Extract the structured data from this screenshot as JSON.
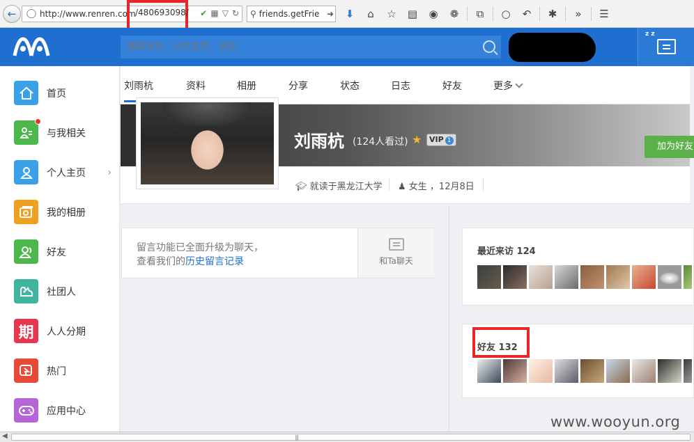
{
  "browser": {
    "url_prefix": "http://www.renren.com",
    "url_id": "/480693098/",
    "search_text": "friends.getFrie"
  },
  "site": {
    "search_placeholder": "搜索好友，公共主页，状态"
  },
  "sidebar": {
    "items": [
      {
        "label": "首页",
        "icon": "home-icon",
        "color": "#3aa0e8"
      },
      {
        "label": "与我相关",
        "icon": "person-card-icon",
        "color": "#4cb84c"
      },
      {
        "label": "个人主页",
        "icon": "person-icon",
        "color": "#3aa0e8"
      },
      {
        "label": "我的相册",
        "icon": "photo-album-icon",
        "color": "#f0a020"
      },
      {
        "label": "好友",
        "icon": "friends-icon",
        "color": "#4cb84c"
      },
      {
        "label": "社团人",
        "icon": "club-icon",
        "color": "#3fb5a0"
      },
      {
        "label": "人人分期",
        "icon": "installment-icon",
        "color": "#e8364f"
      },
      {
        "label": "热门",
        "icon": "hot-icon",
        "color": "#e84a3a"
      },
      {
        "label": "应用中心",
        "icon": "gamepad-icon",
        "color": "#b566d6"
      }
    ],
    "installment_glyph": "期"
  },
  "profile_nav": {
    "tabs": [
      "刘雨杭",
      "资料",
      "相册",
      "分享",
      "状态",
      "日志",
      "好友",
      "更多"
    ]
  },
  "profile": {
    "name": "刘雨杭",
    "views": "(124人看过)",
    "vip_label": "VIP",
    "vip_level": "1",
    "school": "就读于黑龙江大学",
    "gender_birthday": "女生 ，12月8日",
    "add_friend": "加为好友"
  },
  "message": {
    "line1": "留言功能已全面升级为聊天，",
    "line2_prefix": "查看我们的",
    "line2_link": "历史留言记录",
    "chat_label": "和Ta聊天"
  },
  "recent_visitors": {
    "title": "最近来访 124"
  },
  "friends": {
    "title": "好友 132"
  },
  "watermark": "www.wooyun.org",
  "colors": {
    "header_blue": "#1f6fd1",
    "highlight_red": "#e8262a",
    "add_green": "#5bb04a"
  }
}
